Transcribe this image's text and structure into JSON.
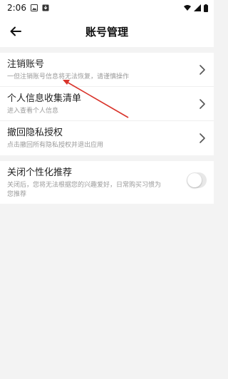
{
  "status_bar": {
    "time": "2:06"
  },
  "header": {
    "title": "账号管理",
    "back_icon": "arrow-left-icon"
  },
  "menu_items": [
    {
      "title": "注销账号",
      "desc": "一但注销账号信息将无法恢复，请谨慎操作"
    },
    {
      "title": "个人信息收集清单",
      "desc": "进入查看个人信息"
    },
    {
      "title": "撤回隐私授权",
      "desc": "点击撤回所有隐私授权并退出应用"
    }
  ],
  "personalization": {
    "title": "关闭个性化推荐",
    "desc": "关闭后，您将无法根据您的兴趣爱好，日常购买习惯为您推荐",
    "enabled": false
  },
  "annotation": {
    "color": "#d9342b"
  }
}
